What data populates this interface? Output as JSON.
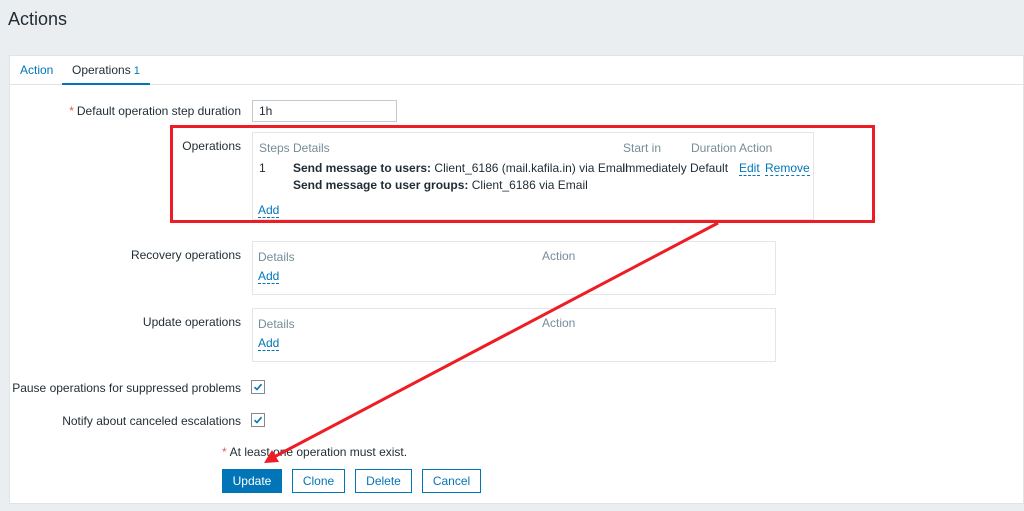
{
  "page": {
    "title": "Actions"
  },
  "tabs": [
    {
      "label": "Action"
    },
    {
      "label": "Operations",
      "count": "1"
    }
  ],
  "form": {
    "step_duration": {
      "label": "Default operation step duration",
      "value": "1h"
    },
    "operations": {
      "label": "Operations",
      "headers": {
        "steps": "Steps",
        "details": "Details",
        "start_in": "Start in",
        "duration": "Duration",
        "action": "Action"
      },
      "rows": [
        {
          "step": "1",
          "detail1_bold": "Send message to users:",
          "detail1_text": "Client_6186 (mail.kafila.in) via Email",
          "detail2_bold": "Send message to user groups:",
          "detail2_text": "Client_6186 via Email",
          "start_in": "Immediately",
          "duration": "Default",
          "edit": "Edit",
          "remove": "Remove"
        }
      ],
      "add": "Add"
    },
    "recovery": {
      "label": "Recovery operations",
      "headers": {
        "details": "Details",
        "action": "Action"
      },
      "add": "Add"
    },
    "update": {
      "label": "Update operations",
      "headers": {
        "details": "Details",
        "action": "Action"
      },
      "add": "Add"
    },
    "pause_suppressed": {
      "label": "Pause operations for suppressed problems",
      "checked": true
    },
    "notify_canceled": {
      "label": "Notify about canceled escalations",
      "checked": true
    },
    "note": "At least one operation must exist."
  },
  "buttons": {
    "update": "Update",
    "clone": "Clone",
    "delete": "Delete",
    "cancel": "Cancel"
  },
  "colors": {
    "accent": "#0275b8",
    "annotation": "#ee1c25",
    "required": "#e45959"
  }
}
